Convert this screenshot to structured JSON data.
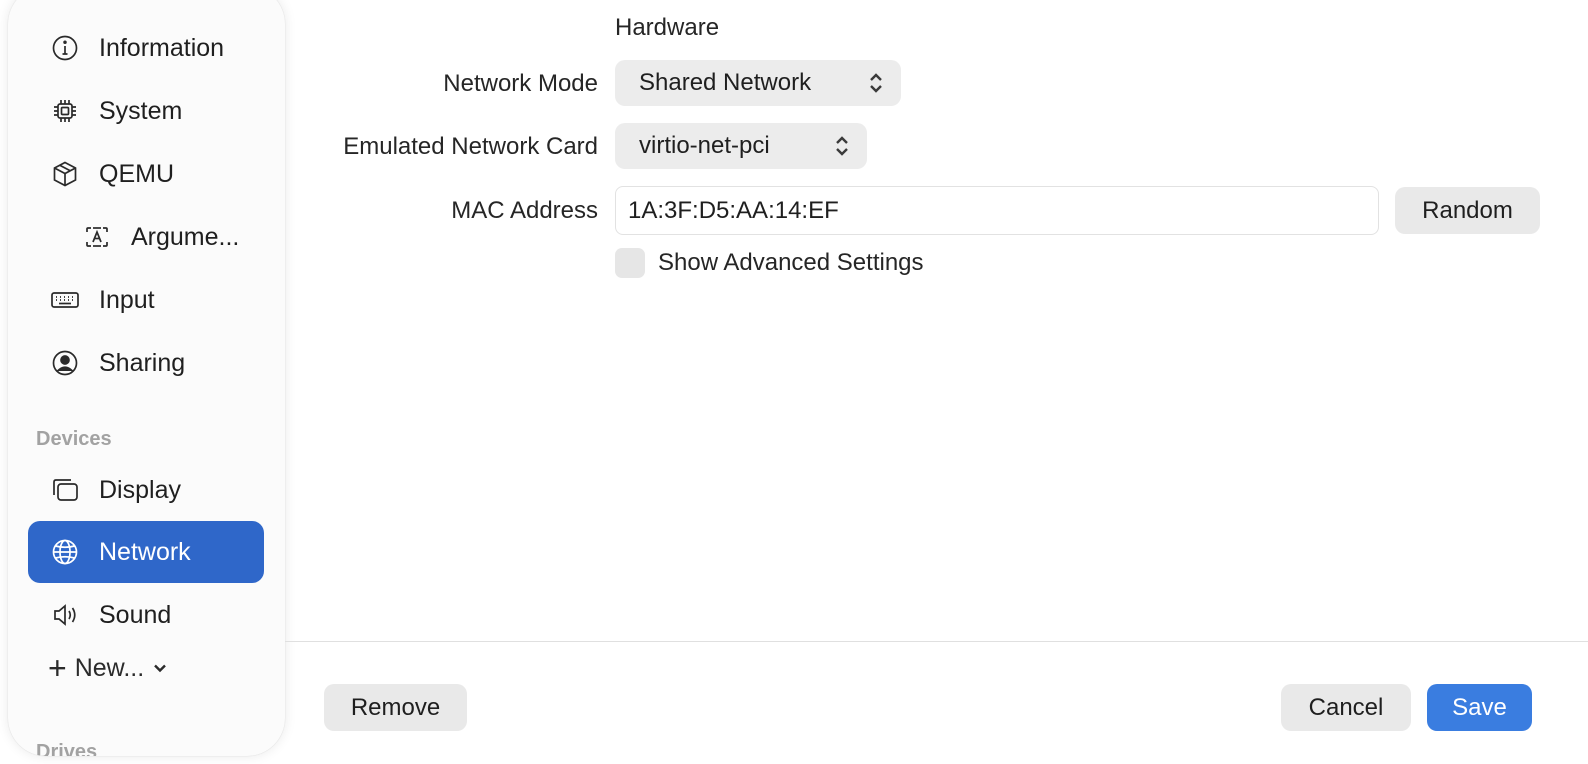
{
  "sidebar": {
    "items": [
      {
        "label": "Information",
        "icon": "info-circle-icon"
      },
      {
        "label": "System",
        "icon": "cpu-chip-icon"
      },
      {
        "label": "QEMU",
        "icon": "cube-icon"
      },
      {
        "label": "Argume...",
        "icon": "text-box-icon"
      },
      {
        "label": "Input",
        "icon": "keyboard-icon"
      },
      {
        "label": "Sharing",
        "icon": "person-circle-icon"
      }
    ],
    "devices_header": "Devices",
    "device_items": [
      {
        "label": "Display",
        "icon": "display-windows-icon"
      },
      {
        "label": "Network",
        "icon": "globe-icon",
        "selected": true
      },
      {
        "label": "Sound",
        "icon": "speaker-icon"
      }
    ],
    "new_label": "New...",
    "drives_header": "Drives"
  },
  "main": {
    "section_title": "Hardware",
    "network_mode": {
      "label": "Network Mode",
      "value": "Shared Network"
    },
    "network_card": {
      "label": "Emulated Network Card",
      "value": "virtio-net-pci"
    },
    "mac_address": {
      "label": "MAC Address",
      "value": "1A:3F:D5:AA:14:EF"
    },
    "random_button": "Random",
    "advanced_checkbox": {
      "label": "Show Advanced Settings",
      "checked": false
    }
  },
  "footer": {
    "remove_label": "Remove",
    "cancel_label": "Cancel",
    "save_label": "Save"
  },
  "colors": {
    "accent": "#2f67c9",
    "primary_button": "#3a7de0"
  }
}
